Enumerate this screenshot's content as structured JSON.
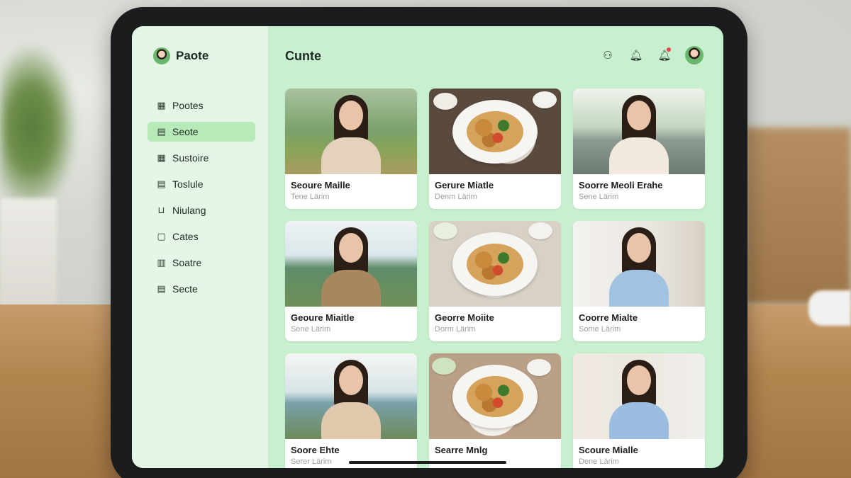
{
  "sidebar": {
    "brand": "Paote",
    "items": [
      {
        "label": "Pootes",
        "icon": "grid-icon",
        "active": false
      },
      {
        "label": "Seote",
        "icon": "calendar-icon",
        "active": true
      },
      {
        "label": "Sustoire",
        "icon": "apps-icon",
        "active": false
      },
      {
        "label": "Toslule",
        "icon": "document-icon",
        "active": false
      },
      {
        "label": "Niulang",
        "icon": "basket-icon",
        "active": false
      },
      {
        "label": "Cates",
        "icon": "note-icon",
        "active": false
      },
      {
        "label": "Soatre",
        "icon": "file-icon",
        "active": false
      },
      {
        "label": "Secte",
        "icon": "list-icon",
        "active": false
      }
    ]
  },
  "header": {
    "title": "Cunte",
    "icons": [
      "user-icon",
      "bell-icon",
      "notification-bell-icon",
      "avatar"
    ]
  },
  "cards": [
    {
      "title": "Seoure Maille",
      "subtitle": "Tene Lärim",
      "thumb": "portrait-park"
    },
    {
      "title": "Gerure Miatle",
      "subtitle": "Denm Lärim",
      "thumb": "food-dark"
    },
    {
      "title": "Soorre Meoli Erahe",
      "subtitle": "Sene Lärim",
      "thumb": "portrait-road"
    },
    {
      "title": "Geoure Miaitle",
      "subtitle": "Sene Lärim",
      "thumb": "portrait-water"
    },
    {
      "title": "Georre Moiite",
      "subtitle": "Dorm Lärim",
      "thumb": "food-light"
    },
    {
      "title": "Coorre Mialte",
      "subtitle": "Some Lärim",
      "thumb": "portrait-room"
    },
    {
      "title": "Soore Ehte",
      "subtitle": "Serer Lärim",
      "thumb": "portrait-beach"
    },
    {
      "title": "Searre Mnlg",
      "subtitle": "",
      "thumb": "food-table"
    },
    {
      "title": "Scoure Mialle",
      "subtitle": "Dene Lärim",
      "thumb": "portrait-room2"
    }
  ],
  "colors": {
    "accent": "#b7eab9",
    "sidebar_bg": "#e4f7e6",
    "main_bg": "#c8f0cf",
    "notification_dot": "#e04646"
  }
}
